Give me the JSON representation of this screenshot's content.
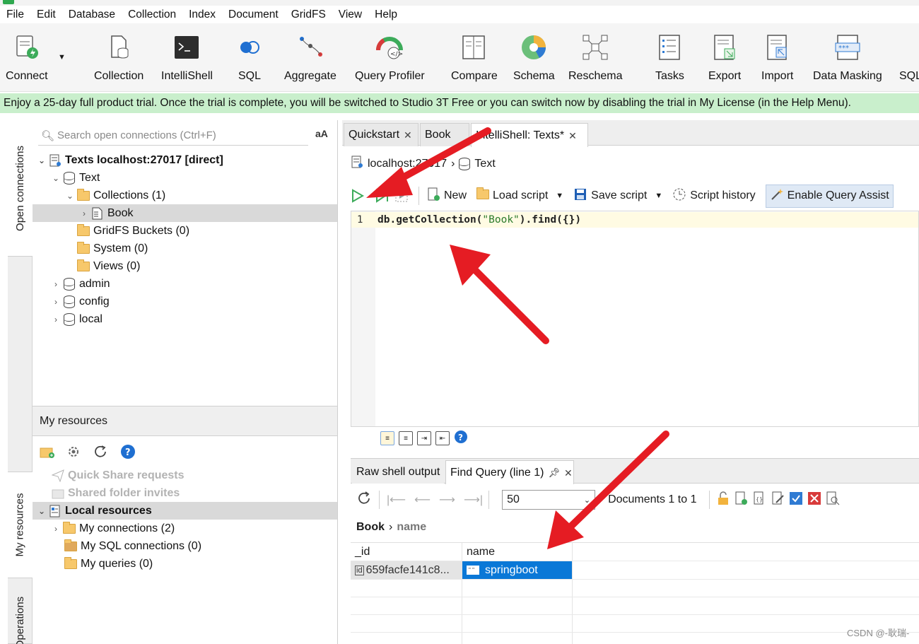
{
  "menu": [
    "File",
    "Edit",
    "Database",
    "Collection",
    "Index",
    "Document",
    "GridFS",
    "View",
    "Help"
  ],
  "toolbar": {
    "connect": "Connect",
    "collection": "Collection",
    "intellishell": "IntelliShell",
    "sql": "SQL",
    "aggregate": "Aggregate",
    "query_profiler": "Query Profiler",
    "compare": "Compare",
    "schema": "Schema",
    "reschema": "Reschema",
    "tasks": "Tasks",
    "export": "Export",
    "import": "Import",
    "data_masking": "Data Masking",
    "sql2": "SQL"
  },
  "banner": "Enjoy a 25-day full product trial. Once the trial is complete, you will be switched to Studio 3T Free or you can switch now by disabling the trial in My License (in the Help Menu).",
  "vtabs": {
    "open_connections": "Open connections",
    "my_resources": "My resources",
    "operations": "Operations"
  },
  "left": {
    "search_placeholder": "Search open connections (Ctrl+F)",
    "aa": "aA",
    "tree": {
      "connection": "Texts localhost:27017 [direct]",
      "db_text": "Text",
      "collections": "Collections (1)",
      "book": "Book",
      "gridfs": "GridFS Buckets (0)",
      "system": "System (0)",
      "views": "Views (0)",
      "admin": "admin",
      "config": "config",
      "local": "local"
    },
    "my_resources": "My resources",
    "quick_share": "Quick Share requests",
    "shared_folder": "Shared folder invites",
    "local_resources": "Local resources",
    "my_connections": "My connections (2)",
    "my_sql_connections": "My SQL connections (0)",
    "my_queries": "My queries (0)"
  },
  "tabs": {
    "quickstart": "Quickstart",
    "book": "Book",
    "intellishell": "IntelliShell: Texts*"
  },
  "crumb": {
    "host": "localhost:27017",
    "db": "Text"
  },
  "editor_toolbar": {
    "new": "New",
    "load": "Load script",
    "save": "Save script",
    "history": "Script history",
    "query_assist": "Enable Query Assist"
  },
  "editor": {
    "line_number": "1",
    "code_prefix": "db.getCollection(",
    "code_string": "\"Book\"",
    "code_suffix": ").find({})"
  },
  "results": {
    "tab_raw": "Raw shell output",
    "tab_find": "Find Query (line 1)",
    "page_size": "50",
    "documents": "Documents 1 to 1",
    "path_collection": "Book",
    "path_field": "name",
    "columns": [
      "_id",
      "name"
    ],
    "row_id": "659facfe141c8...",
    "row_name": "springboot"
  },
  "watermark": "CSDN @-耿瑞-",
  "colors": {
    "banner": "#c9efcc",
    "selection": "#0a78d7",
    "arrow": "#e51c23",
    "run_green": "#3cab5a"
  }
}
